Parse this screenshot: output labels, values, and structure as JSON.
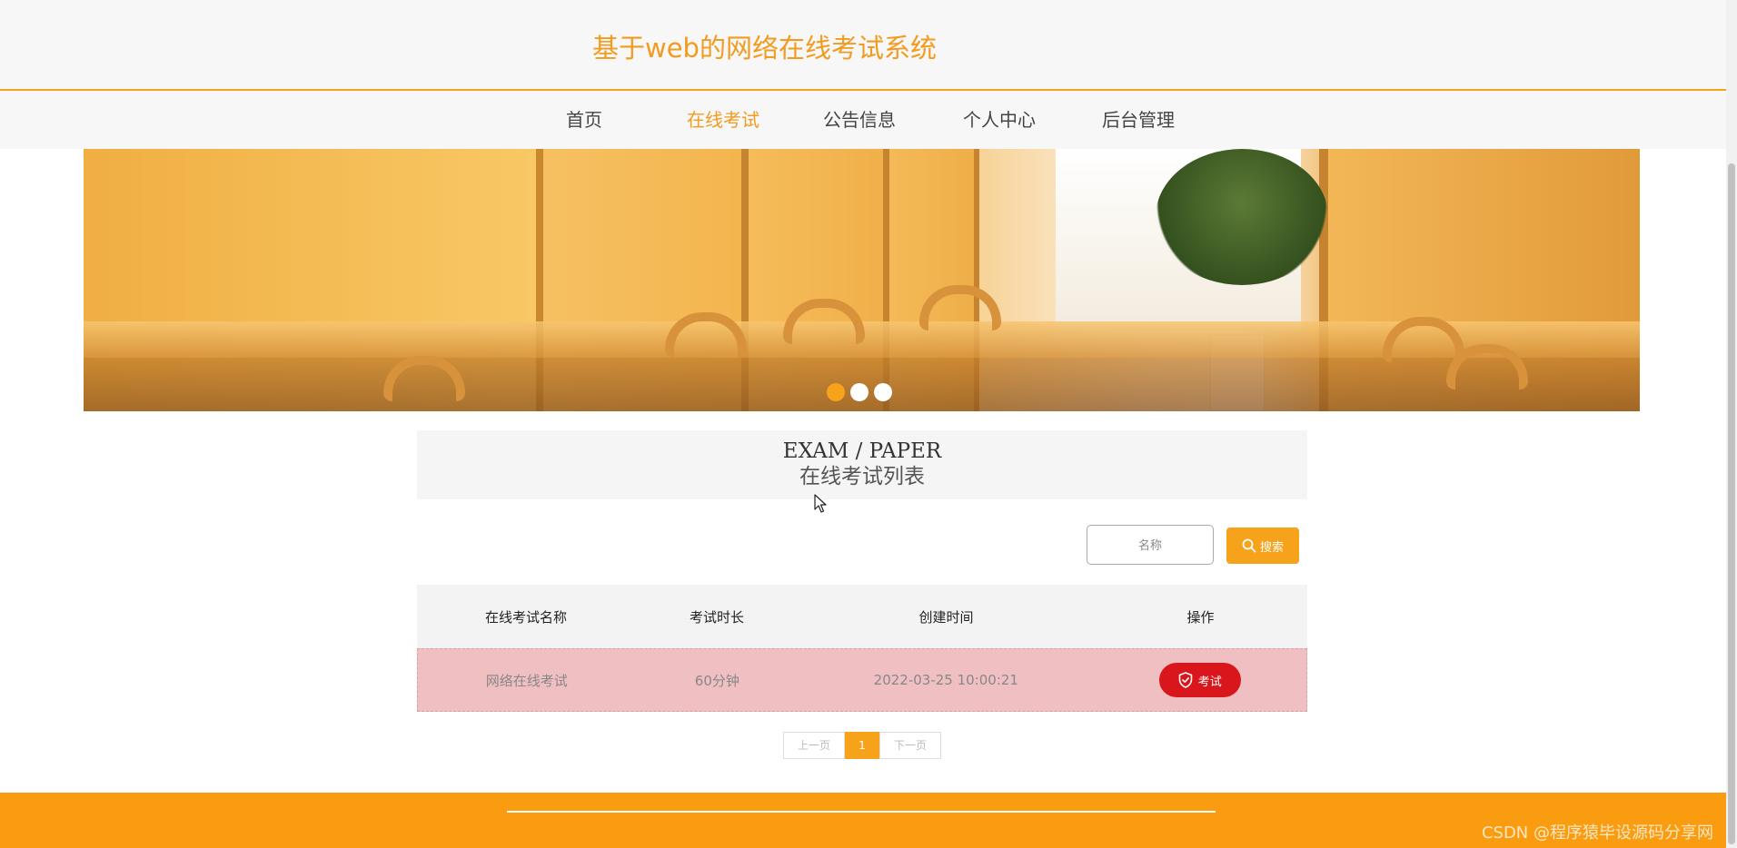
{
  "site": {
    "title": "基于web的网络在线考试系统"
  },
  "nav": {
    "items": [
      {
        "label": "首页"
      },
      {
        "label": "在线考试",
        "active": true
      },
      {
        "label": "公告信息"
      },
      {
        "label": "个人中心"
      },
      {
        "label": "后台管理"
      }
    ]
  },
  "carousel": {
    "slides": 3,
    "active_index": 0
  },
  "section": {
    "title_en": "EXAM / PAPER",
    "title_cn": "在线考试列表"
  },
  "search": {
    "placeholder": "名称",
    "button_label": "搜索"
  },
  "table": {
    "headers": [
      "在线考试名称",
      "考试时长",
      "创建时间",
      "操作"
    ],
    "rows": [
      {
        "name": "网络在线考试",
        "duration": "60分钟",
        "created": "2022-03-25 10:00:21",
        "action": "考试"
      }
    ]
  },
  "pagination": {
    "prev": "上一页",
    "current": "1",
    "next": "下一页"
  },
  "footer": {
    "watermark": "CSDN @程序猿毕设源码分享网"
  },
  "colors": {
    "accent": "#f7a21b",
    "exam_button": "#d8161b",
    "row_highlight": "#f0bfc1"
  }
}
